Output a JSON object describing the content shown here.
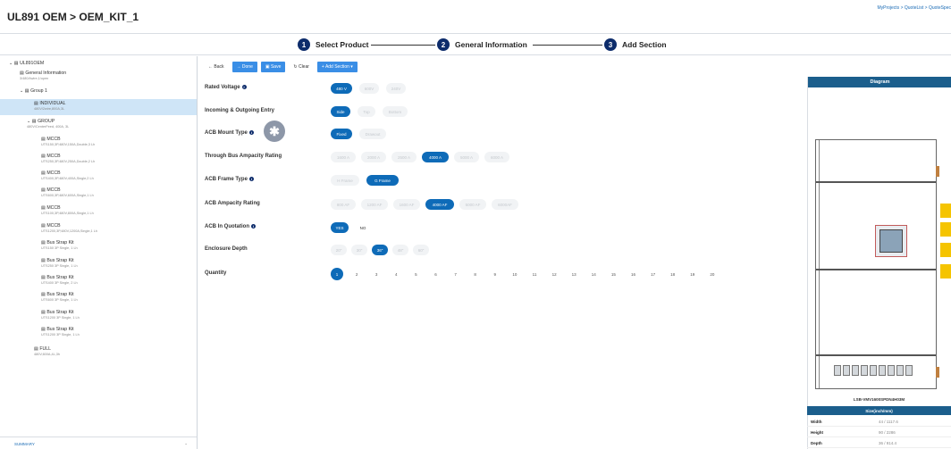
{
  "header": {
    "title": "UL891 OEM > OEM_KIT_1",
    "breadcrumb": "MyProjects > QuoteList > QuoteSpec"
  },
  "stepper": {
    "steps": [
      {
        "num": "1",
        "label": "Select Product"
      },
      {
        "num": "2",
        "label": "General Information"
      },
      {
        "num": "3",
        "label": "Add Section"
      }
    ]
  },
  "sidebar": {
    "root": "UL891OEM",
    "general": {
      "label": "General Information",
      "sub": "3/480/4wire,1/open"
    },
    "group1": "Group 1",
    "individual": {
      "label": "INDIVIDUAL",
      "sub": "480V/2wire,800A,3L"
    },
    "group": {
      "label": "GROUP",
      "sub": "480V/CenterFeed, 400A, 3L"
    },
    "mccbs": [
      {
        "label": "MCCB",
        "sub": "UTS150,3P,480V,150A,Double,3 Lh"
      },
      {
        "label": "MCCB",
        "sub": "UTS250,3P,480V,250A,Double,2 Lh"
      },
      {
        "label": "MCCB",
        "sub": "UTS400,3P,480V,400A,Single,2 Lh"
      },
      {
        "label": "MCCB",
        "sub": "UTS600,3P,480V,600A,Single,1 Lh"
      },
      {
        "label": "MCCB",
        "sub": "UTS100,3P,480V,800A,Single,1 Lh"
      },
      {
        "label": "MCCB",
        "sub": "UTS1200,3P,480V,1200A,Single,1 Lh"
      }
    ],
    "busstraps": [
      {
        "label": "Bus Strap Kit",
        "sub": "UTS150 3P Single, 1 Lh"
      },
      {
        "label": "Bus Strap Kit",
        "sub": "UTS250 3P Single, 1 Lh"
      },
      {
        "label": "Bus Strap Kit",
        "sub": "UTS400 3P Single, 2 Lh"
      },
      {
        "label": "Bus Strap Kit",
        "sub": "UTS600 3P Single, 1 Lh"
      },
      {
        "label": "Bus Strap Kit",
        "sub": "UTS1200 3P Single, 1 Lh"
      },
      {
        "label": "Bus Strap Kit",
        "sub": "UTS1200 3P Single, 1 Lh"
      }
    ],
    "full": {
      "label": "FULL",
      "sub": "480V,600A,4L,3h"
    },
    "summary": "SUMMARY"
  },
  "toolbar": {
    "back": "← Back",
    "done": "→ Done",
    "save": "▣ Save",
    "clear": "↻ Clear",
    "add_section": "+ Add Section ▾"
  },
  "form": {
    "rated_voltage": {
      "label": "Rated Voltage",
      "options": [
        "480 V",
        "600V",
        "240V"
      ],
      "selected": 0
    },
    "incoming": {
      "label": "Incoming & Outgoing Entry",
      "options": [
        "Side",
        "Top",
        "Bottom"
      ],
      "selected": 0
    },
    "acb_mount": {
      "label": "ACB Mount Type",
      "options": [
        "Fixed",
        "Drawout"
      ],
      "selected": 0
    },
    "through_bus": {
      "label": "Through Bus Ampacity Rating",
      "options": [
        "1600 A",
        "2000 A",
        "2500 A",
        "4000 A",
        "5000 A",
        "6000 A"
      ],
      "selected": 3
    },
    "acb_frame": {
      "label": "ACB Frame Type",
      "options": [
        "H Frame",
        "G Frame"
      ],
      "selected": 1
    },
    "acb_ampacity": {
      "label": "ACB Ampacity Rating",
      "options": [
        "800 AF",
        "1200 AF",
        "1600 AF",
        "4000 AF",
        "5000 AF",
        "6000AF"
      ],
      "selected": 3
    },
    "acb_quotation": {
      "label": "ACB In Quotation",
      "options": [
        "YES",
        "NO"
      ],
      "selected": 0
    },
    "enclosure_depth": {
      "label": "Enclosure Depth",
      "options": [
        "20\"",
        "30\"",
        "36\"",
        "48\"",
        "60\""
      ],
      "selected": 2
    },
    "quantity": {
      "label": "Quantity",
      "options": [
        "1",
        "2",
        "3",
        "4",
        "5",
        "6",
        "7",
        "8",
        "9",
        "10",
        "11",
        "12",
        "13",
        "14",
        "15",
        "16",
        "17",
        "18",
        "19",
        "20"
      ],
      "selected": 0
    }
  },
  "markers": {
    "star": "✱",
    "two": "2"
  },
  "diagram": {
    "title": "Diagram",
    "model": "LSB-VMV1600SPDN4H03M",
    "size_title": "Size(inch/mm)",
    "rows": [
      {
        "k": "Width",
        "v": "44 / 1117.6"
      },
      {
        "k": "Height",
        "v": "90 / 2286"
      },
      {
        "k": "Depth",
        "v": "36 / 914.4"
      }
    ]
  },
  "colors": {
    "accent": "#0e6bb8",
    "navy": "#0d2c6b",
    "selection": "#cfe5f7"
  }
}
